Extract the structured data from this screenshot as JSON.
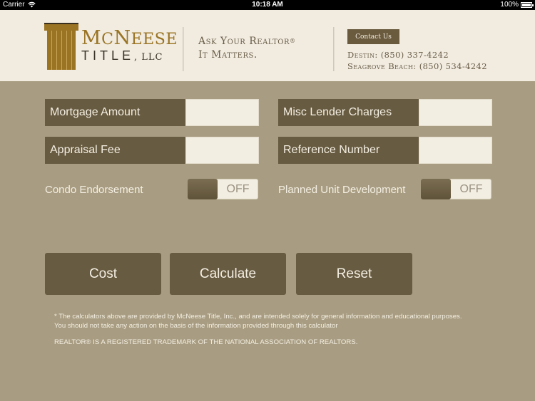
{
  "status_bar": {
    "carrier": "Carrier",
    "time": "10:18 AM",
    "battery": "100%"
  },
  "header": {
    "logo": {
      "name_big1": "M",
      "name_small1": "C",
      "name_big2": "N",
      "name_small2": "EESE",
      "subtitle": "TITLE",
      "suffix": ", LLC"
    },
    "tagline": {
      "line1": "Ask Your Realtor",
      "reg_mark": "®",
      "line2": "It Matters."
    },
    "contact_button": "Contact Us",
    "phones": [
      "Destin: (850) 337-4242",
      "Seagrove Beach: (850) 534-4242"
    ]
  },
  "form": {
    "fields": [
      {
        "label": "Mortgage Amount",
        "value": "",
        "placeholder": ""
      },
      {
        "label": "Misc Lender Charges",
        "value": "",
        "placeholder": ""
      },
      {
        "label": "Appraisal Fee",
        "value": "",
        "placeholder": ""
      },
      {
        "label": "Reference Number",
        "value": "",
        "placeholder": ""
      }
    ],
    "toggles": [
      {
        "label": "Condo Endorsement",
        "state": "OFF"
      },
      {
        "label": "Planned Unit Development",
        "state": "OFF"
      }
    ]
  },
  "buttons": {
    "cost": "Cost",
    "calculate": "Calculate",
    "reset": "Reset"
  },
  "footer": {
    "disclaimer_line1": "* The calculators above are provided by McNeese Title, Inc., and are intended solely for general information and educational purposes.",
    "disclaimer_line2": "You should not take any action on the basis of the information provided through this calculator",
    "trademark": "REALTOR® IS A REGISTERED TRADEMARK OF THE NATIONAL ASSOCIATION OF REALTORS."
  },
  "colors": {
    "background": "#a89d82",
    "header_bg": "#f1ebe0",
    "panel_dark": "#675b41",
    "input_bg": "#f3eee2",
    "logo_gold": "#9a7423",
    "text_light": "#f4eee2"
  }
}
